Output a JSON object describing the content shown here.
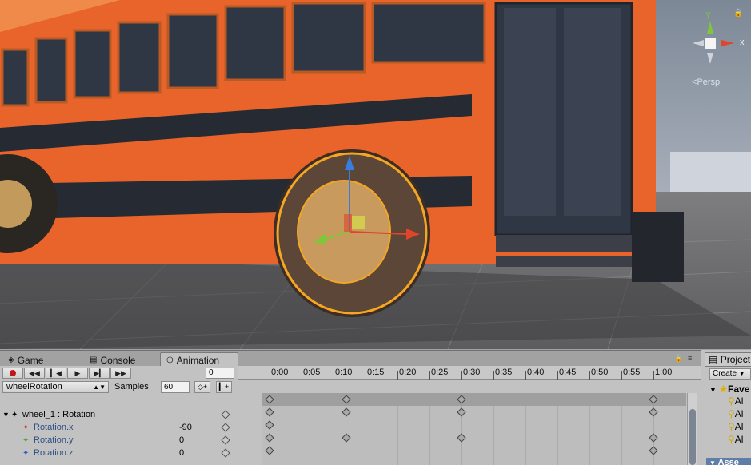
{
  "scene": {
    "gizmo": {
      "y_label": "y",
      "x_label": "x",
      "projection": "Persp"
    }
  },
  "tabs": [
    {
      "label": "Game",
      "icon": "game-icon"
    },
    {
      "label": "Console",
      "icon": "console-icon"
    },
    {
      "label": "Animation",
      "icon": "clock-icon"
    }
  ],
  "animation": {
    "current_frame": "0",
    "clip_name": "wheelRotation",
    "samples_label": "Samples",
    "samples_value": "60",
    "object_label": "wheel_1 : Rotation",
    "properties": [
      {
        "name": "Rotation.x",
        "value": "-90"
      },
      {
        "name": "Rotation.y",
        "value": "0"
      },
      {
        "name": "Rotation.z",
        "value": "0"
      }
    ],
    "time_labels": [
      "0:00",
      "0:05",
      "0:10",
      "0:15",
      "0:20",
      "0:25",
      "0:30",
      "0:35",
      "0:40",
      "0:45",
      "0:50",
      "0:55",
      "1:00"
    ],
    "playhead_time": "0:00",
    "keyframe_times": [
      "0:00",
      "0:12",
      "0:30",
      "1:00"
    ]
  },
  "project": {
    "tab_label": "Project",
    "create_label": "Create",
    "favorites_label": "Fave",
    "favorite_items": [
      "Al",
      "Al",
      "Al",
      "Al"
    ],
    "assets_label": "Asse"
  },
  "colors": {
    "record": "#c0161a",
    "playhead": "#d01818",
    "bus_orange": "#e8642a",
    "selection_outline": "#f5a623"
  }
}
